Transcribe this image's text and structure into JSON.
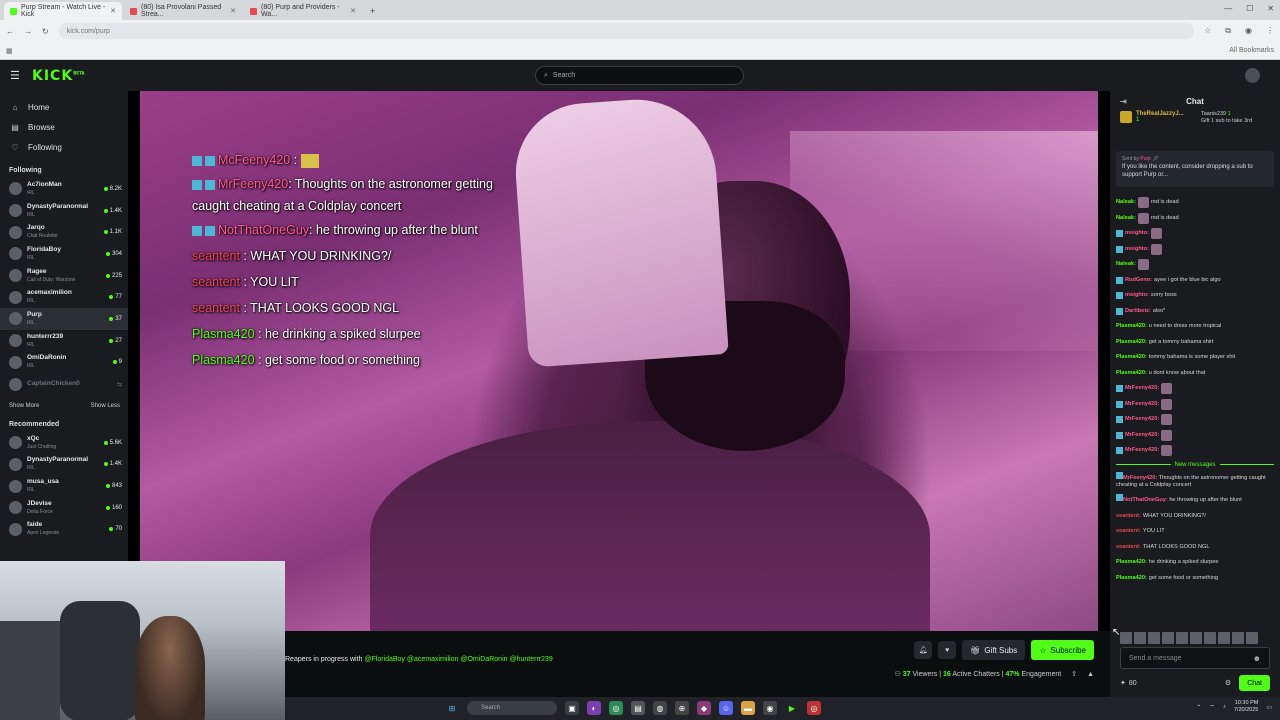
{
  "browser": {
    "tabs": [
      {
        "label": "Purp Stream - Watch Live - Kick",
        "active": true,
        "fav": "#53fc18"
      },
      {
        "label": "(80) Isa Provolani Passed Strea...",
        "active": false,
        "fav": "#e6484f"
      },
      {
        "label": "(80) Purp and Providers - Wa...",
        "active": false,
        "fav": "#e6484f"
      }
    ],
    "new_tab": "+",
    "url": "kick.com/purp",
    "all_bookmarks": "All Bookmarks"
  },
  "header": {
    "logo": "KICK",
    "logo_sup": "BETA",
    "search_placeholder": "Search"
  },
  "sidebar": {
    "nav": [
      {
        "label": "Home",
        "icon": "home-icon",
        "glyph": "⌂"
      },
      {
        "label": "Browse",
        "icon": "browse-icon",
        "glyph": "▤"
      },
      {
        "label": "Following",
        "icon": "heart-icon",
        "glyph": "♡"
      }
    ],
    "following_title": "Following",
    "following": [
      {
        "name": "Ac7ionMan",
        "category": "IRL",
        "viewers": "8.2K"
      },
      {
        "name": "DynastyParanormal",
        "category": "IRL",
        "viewers": "1.4K"
      },
      {
        "name": "Jarqo",
        "category": "Chat Roulette",
        "viewers": "1.1K"
      },
      {
        "name": "FloridaBoy",
        "category": "IRL",
        "viewers": "304"
      },
      {
        "name": "Ragee",
        "category": "Call of Duty: Warzone",
        "viewers": "225"
      },
      {
        "name": "acemaximilion",
        "category": "IRL",
        "viewers": "77"
      },
      {
        "name": "Purp",
        "category": "IRL",
        "viewers": "37"
      },
      {
        "name": "hunterrr239",
        "category": "IRL",
        "viewers": "27"
      },
      {
        "name": "OmiDaRonin",
        "category": "IRL",
        "viewers": "9"
      },
      {
        "name": "CaptainChicken0",
        "category": "",
        "viewers": ""
      }
    ],
    "show_more": "Show More",
    "show_less": "Show Less",
    "recommended_title": "Recommended",
    "recommended": [
      {
        "name": "xQc",
        "category": "Just Chatting",
        "viewers": "5.6K"
      },
      {
        "name": "DynastyParanormal",
        "category": "IRL",
        "viewers": "1.4K"
      },
      {
        "name": "musa_usa",
        "category": "IRL",
        "viewers": "843"
      },
      {
        "name": "JDevise",
        "category": "Delta Force",
        "viewers": "160"
      },
      {
        "name": "faide",
        "category": "Apex Legends",
        "viewers": "70"
      }
    ]
  },
  "overlay_chat": [
    {
      "user": "McFeeny420",
      "sep": " : ",
      "text": "",
      "color": "#ff5a8a",
      "badge": true,
      "emote": true
    },
    {
      "user": "MrFeeny420",
      "sep": ": ",
      "text": "Thoughts on the astronomer getting caught cheating at a Coldplay concert",
      "color": "#ff5a8a",
      "badge": true,
      "emote": false
    },
    {
      "user": "NotThatOneGuy",
      "sep": ": ",
      "text": "he throwing up after the blunt",
      "color": "#ff5a8a",
      "badge": true,
      "emote": false
    },
    {
      "user": "seantent",
      "sep": " : ",
      "text": "WHAT YOU DRINKING?/",
      "color": "#e6484f",
      "badge": false,
      "emote": false
    },
    {
      "user": "seantent",
      "sep": " : ",
      "text": "YOU LIT",
      "color": "#e6484f",
      "badge": false,
      "emote": false
    },
    {
      "user": "seantent",
      "sep": " : ",
      "text": "THAT LOOKS GOOD NGL",
      "color": "#e6484f",
      "badge": false,
      "emote": false
    },
    {
      "user": "Plasma420",
      "sep": " : ",
      "text": "he drinking a spiked slurpee",
      "color": "#53fc18",
      "badge": false,
      "emote": false
    },
    {
      "user": "Plasma420",
      "sep": " : ",
      "text": "get some food or something",
      "color": "#53fc18",
      "badge": false,
      "emote": false
    }
  ],
  "stream": {
    "title_prefix": "Reapers in progress with",
    "mentions": [
      "@FloridaBoy",
      "@acemaximilion",
      "@OmiDaRonin",
      "@hunterrr239"
    ],
    "gift_subs": "Gift Subs",
    "subscribe": "Subscribe",
    "viewers": "37",
    "viewers_label": "Viewers",
    "chatters": "16",
    "chatters_label": "Active Chatters",
    "engagement": "47%",
    "engagement_label": "Engagement"
  },
  "chat": {
    "title": "Chat",
    "pin_user": "TheRealJazzyJ...",
    "pin_count": "1",
    "gift_user": "Taanis239",
    "gift_count": "1",
    "gift_text": "Gift 1 sub to take 3rd",
    "pinned_sent_by": "Sent by",
    "pinned_sender": "Purp",
    "pinned_text": "If you like the content, consider dropping a sub to support Purp or...",
    "messages": [
      {
        "user": "Naleak:",
        "text": "red is dead",
        "cls": "u-green",
        "emote": true
      },
      {
        "user": "Naleak:",
        "text": "red is dead",
        "cls": "u-green",
        "emote": true
      },
      {
        "user": "moighto:",
        "text": "",
        "cls": "u-pink",
        "emote": true
      },
      {
        "user": "moighto:",
        "text": "",
        "cls": "u-pink",
        "emote": true
      },
      {
        "user": "Naleak:",
        "text": "",
        "cls": "u-green",
        "emote": true
      },
      {
        "user": "RudGeno:",
        "text": "ayee i got the blue bic algo",
        "cls": "u-pink",
        "emote": false
      },
      {
        "user": "moighto:",
        "text": "sorry boss",
        "cls": "u-pink",
        "emote": false
      },
      {
        "user": "Dartiboiz:",
        "text": "also*",
        "cls": "u-pink",
        "emote": false
      },
      {
        "user": "Plasma420:",
        "text": "u need to dress more tropical",
        "cls": "u-green",
        "emote": false
      },
      {
        "user": "Plasma420:",
        "text": "get a tommy bahama shirt",
        "cls": "u-green",
        "emote": false
      },
      {
        "user": "Plasma420:",
        "text": "tommy bahama is some player shit",
        "cls": "u-green",
        "emote": false
      },
      {
        "user": "Plasma420:",
        "text": "u dont know about that",
        "cls": "u-green",
        "emote": false
      },
      {
        "user": "MrFeeny420:",
        "text": "",
        "cls": "u-pink",
        "emote": true
      },
      {
        "user": "MrFeeny420:",
        "text": "",
        "cls": "u-pink",
        "emote": true
      },
      {
        "user": "MrFeeny420:",
        "text": "",
        "cls": "u-pink",
        "emote": true
      },
      {
        "user": "MrFeeny420:",
        "text": "",
        "cls": "u-pink",
        "emote": true
      },
      {
        "user": "MrFeeny420:",
        "text": "",
        "cls": "u-pink",
        "emote": true
      }
    ],
    "new_messages": "New messages",
    "new": [
      {
        "user": "MrFeeny420:",
        "text": "Thoughts on the astronomer getting caught cheating at a Coldplay concert",
        "cls": "u-pink",
        "wrap": true
      },
      {
        "user": "NotThatOneGuy:",
        "text": "he throwing up after the blunt",
        "cls": "u-pink",
        "wrap": true
      },
      {
        "user": "seantent:",
        "text": "WHAT YOU DRINKING?/",
        "cls": "u-red",
        "wrap": false
      },
      {
        "user": "seantent:",
        "text": "YOU LIT",
        "cls": "u-red",
        "wrap": false
      },
      {
        "user": "seantent:",
        "text": "THAT LOOKS GOOD NGL",
        "cls": "u-red",
        "wrap": false
      },
      {
        "user": "Plasma420:",
        "text": "he drinking a spiked slurpee",
        "cls": "u-green",
        "wrap": false
      },
      {
        "user": "Plasma420:",
        "text": "get some food or something",
        "cls": "u-green",
        "wrap": false
      }
    ],
    "input_placeholder": "Send a message",
    "points": "80",
    "chat_button": "Chat"
  },
  "taskbar": {
    "search": "Search",
    "time": "10:30 PM",
    "date": "7/20/2025"
  },
  "colors": {
    "accent": "#53fc18",
    "bg": "#0b0e0f",
    "panel": "#191b1f"
  }
}
